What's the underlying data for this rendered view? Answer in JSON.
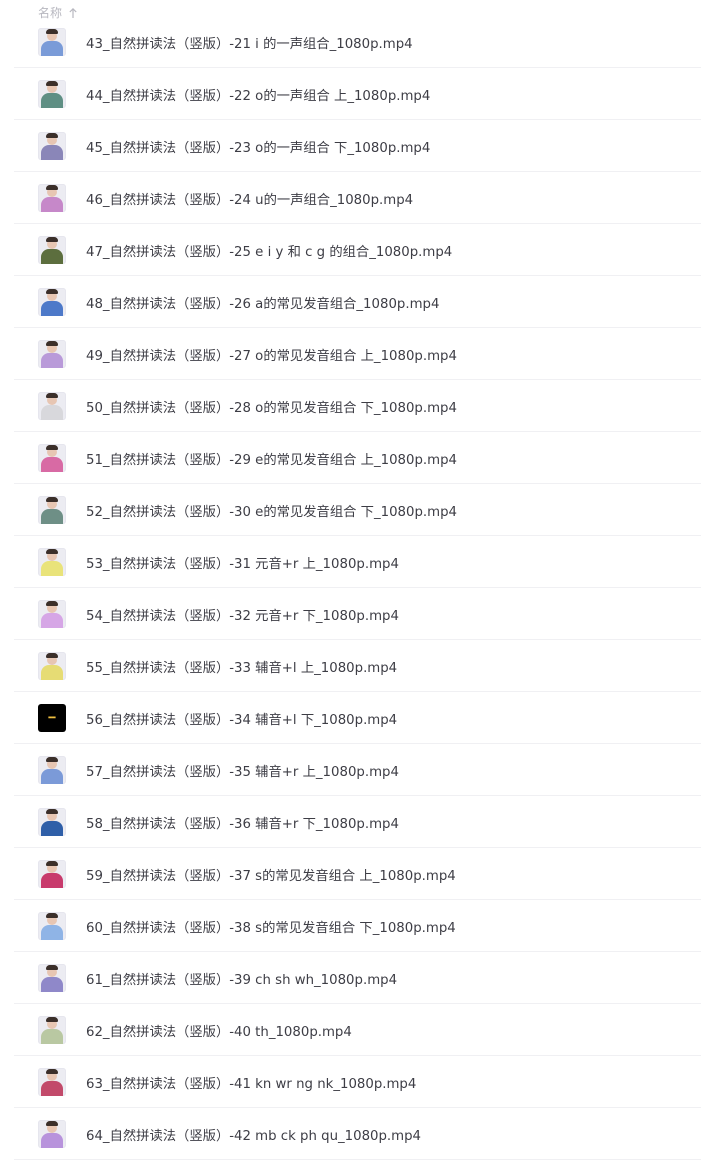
{
  "header": {
    "column_name": "名称",
    "sort_icon": "arrow-up-icon"
  },
  "files": [
    {
      "name": "43_自然拼读法（竖版）-21 i 的一声组合_1080p.mp4",
      "shirt": "#7a9bd8"
    },
    {
      "name": "44_自然拼读法（竖版）-22 o的一声组合 上_1080p.mp4",
      "shirt": "#5f8f84"
    },
    {
      "name": "45_自然拼读法（竖版）-23 o的一声组合 下_1080p.mp4",
      "shirt": "#8a86b8"
    },
    {
      "name": "46_自然拼读法（竖版）-24 u的一声组合_1080p.mp4",
      "shirt": "#c688c9"
    },
    {
      "name": "47_自然拼读法（竖版）-25 e i y 和 c g 的组合_1080p.mp4",
      "shirt": "#5c6e3e"
    },
    {
      "name": "48_自然拼读法（竖版）-26 a的常见发音组合_1080p.mp4",
      "shirt": "#4d79c9"
    },
    {
      "name": "49_自然拼读法（竖版）-27 o的常见发音组合 上_1080p.mp4",
      "shirt": "#b99ad9"
    },
    {
      "name": "50_自然拼读法（竖版）-28 o的常见发音组合 下_1080p.mp4",
      "shirt": "#d8d8dc"
    },
    {
      "name": "51_自然拼读法（竖版）-29 e的常见发音组合 上_1080p.mp4",
      "shirt": "#d86aa4"
    },
    {
      "name": "52_自然拼读法（竖版）-30 e的常见发音组合 下_1080p.mp4",
      "shirt": "#6e8f86"
    },
    {
      "name": "53_自然拼读法（竖版）-31 元音+r 上_1080p.mp4",
      "shirt": "#e9e37a"
    },
    {
      "name": "54_自然拼读法（竖版）-32 元音+r 下_1080p.mp4",
      "shirt": "#d6a6e6"
    },
    {
      "name": "55_自然拼读法（竖版）-33 辅音+l 上_1080p.mp4",
      "shirt": "#e6dc74"
    },
    {
      "name": "56_自然拼读法（竖版）-34 辅音+l 下_1080p.mp4",
      "shirt": "#000000"
    },
    {
      "name": "57_自然拼读法（竖版）-35 辅音+r 上_1080p.mp4",
      "shirt": "#7b9ad8"
    },
    {
      "name": "58_自然拼读法（竖版）-36 辅音+r 下_1080p.mp4",
      "shirt": "#2f5fa8"
    },
    {
      "name": "59_自然拼读法（竖版）-37 s的常见发音组合 上_1080p.mp4",
      "shirt": "#c83a6c"
    },
    {
      "name": "60_自然拼读法（竖版）-38 s的常见发音组合 下_1080p.mp4",
      "shirt": "#8fb4e6"
    },
    {
      "name": "61_自然拼读法（竖版）-39 ch sh wh_1080p.mp4",
      "shirt": "#8f88c9"
    },
    {
      "name": "62_自然拼读法（竖版）-40 th_1080p.mp4",
      "shirt": "#b9c8a2"
    },
    {
      "name": "63_自然拼读法（竖版）-41 kn wr ng nk_1080p.mp4",
      "shirt": "#c24a6a"
    },
    {
      "name": "64_自然拼读法（竖版）-42 mb ck ph qu_1080p.mp4",
      "shirt": "#b893dc"
    }
  ]
}
